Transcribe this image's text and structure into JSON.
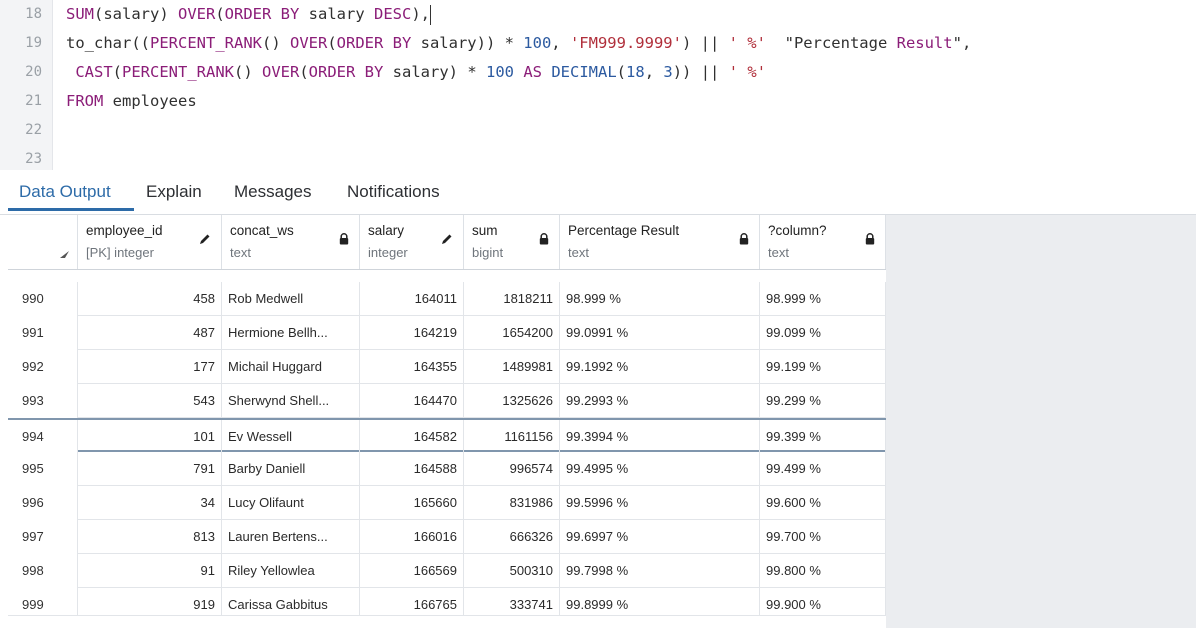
{
  "editor": {
    "lines": [
      {
        "n": "18",
        "parts": [
          [
            "fn",
            "SUM"
          ],
          [
            "p",
            "(salary) "
          ],
          [
            "kw",
            "OVER"
          ],
          [
            "p",
            "("
          ],
          [
            "kw",
            "ORDER BY"
          ],
          [
            "p",
            " salary "
          ],
          [
            "kw",
            "DESC"
          ],
          [
            "p",
            "),"
          ]
        ]
      },
      {
        "n": "19",
        "parts": [
          [
            "p",
            "to_char(("
          ],
          [
            "fn",
            "PERCENT_RANK"
          ],
          [
            "p",
            "() "
          ],
          [
            "kw",
            "OVER"
          ],
          [
            "p",
            "("
          ],
          [
            "kw",
            "ORDER BY"
          ],
          [
            "p",
            " salary)) * "
          ],
          [
            "num",
            "100"
          ],
          [
            "p",
            ", "
          ],
          [
            "str",
            "'FM999.9999'"
          ],
          [
            "p",
            ") || "
          ],
          [
            "str",
            "' %'"
          ],
          [
            "p",
            "  "
          ],
          [
            "p",
            "\"Percentage "
          ],
          [
            "kw",
            "Result"
          ],
          [
            "p",
            "\","
          ]
        ]
      },
      {
        "n": "20",
        "parts": [
          [
            "p",
            " "
          ],
          [
            "kw",
            "CAST"
          ],
          [
            "p",
            "("
          ],
          [
            "fn",
            "PERCENT_RANK"
          ],
          [
            "p",
            "() "
          ],
          [
            "kw",
            "OVER"
          ],
          [
            "p",
            "("
          ],
          [
            "kw",
            "ORDER BY"
          ],
          [
            "p",
            " salary) * "
          ],
          [
            "num",
            "100"
          ],
          [
            "p",
            " "
          ],
          [
            "kw",
            "AS"
          ],
          [
            "p",
            " "
          ],
          [
            "num",
            "DECIMAL"
          ],
          [
            "p",
            "("
          ],
          [
            "num",
            "18"
          ],
          [
            "p",
            ", "
          ],
          [
            "num",
            "3"
          ],
          [
            "p",
            ")) || "
          ],
          [
            "str",
            "' %'"
          ]
        ]
      },
      {
        "n": "21",
        "parts": [
          [
            "kw",
            "FROM"
          ],
          [
            "p",
            " employees"
          ]
        ]
      },
      {
        "n": "22",
        "parts": []
      },
      {
        "n": "23",
        "parts": []
      }
    ]
  },
  "tabs": {
    "data_output": "Data Output",
    "explain": "Explain",
    "messages": "Messages",
    "notifications": "Notifications"
  },
  "columns": [
    {
      "name": "employee_id",
      "type": "[PK] integer",
      "icon": "pencil-icon"
    },
    {
      "name": "concat_ws",
      "type": "text",
      "icon": "lock-icon"
    },
    {
      "name": "salary",
      "type": "integer",
      "icon": "pencil-icon"
    },
    {
      "name": "sum",
      "type": "bigint",
      "icon": "lock-icon"
    },
    {
      "name": "Percentage Result",
      "type": "text",
      "icon": "lock-icon"
    },
    {
      "name": "?column?",
      "type": "text",
      "icon": "lock-icon"
    }
  ],
  "rows": [
    {
      "rn": "990",
      "employee_id": "458",
      "concat_ws": "Rob Medwell",
      "salary": "164011",
      "sum": "1818211",
      "pct": "98.999 %",
      "col": "98.999 %"
    },
    {
      "rn": "991",
      "employee_id": "487",
      "concat_ws": "Hermione Bellh...",
      "salary": "164219",
      "sum": "1654200",
      "pct": "99.0991 %",
      "col": "99.099 %"
    },
    {
      "rn": "992",
      "employee_id": "177",
      "concat_ws": "Michail Huggard",
      "salary": "164355",
      "sum": "1489981",
      "pct": "99.1992 %",
      "col": "99.199 %"
    },
    {
      "rn": "993",
      "employee_id": "543",
      "concat_ws": "Sherwynd Shell...",
      "salary": "164470",
      "sum": "1325626",
      "pct": "99.2993 %",
      "col": "99.299 %"
    },
    {
      "rn": "994",
      "employee_id": "101",
      "concat_ws": "Ev Wessell",
      "salary": "164582",
      "sum": "1161156",
      "pct": "99.3994 %",
      "col": "99.399 %"
    },
    {
      "rn": "995",
      "employee_id": "791",
      "concat_ws": "Barby Daniell",
      "salary": "164588",
      "sum": "996574",
      "pct": "99.4995 %",
      "col": "99.499 %"
    },
    {
      "rn": "996",
      "employee_id": "34",
      "concat_ws": "Lucy Olifaunt",
      "salary": "165660",
      "sum": "831986",
      "pct": "99.5996 %",
      "col": "99.600 %"
    },
    {
      "rn": "997",
      "employee_id": "813",
      "concat_ws": "Lauren Bertens...",
      "salary": "166016",
      "sum": "666326",
      "pct": "99.6997 %",
      "col": "99.700 %"
    },
    {
      "rn": "998",
      "employee_id": "91",
      "concat_ws": "Riley Yellowlea",
      "salary": "166569",
      "sum": "500310",
      "pct": "99.7998 %",
      "col": "99.800 %"
    },
    {
      "rn": "999",
      "employee_id": "919",
      "concat_ws": "Carissa Gabbitus",
      "salary": "166765",
      "sum": "333741",
      "pct": "99.8999 %",
      "col": "99.900 %"
    }
  ],
  "selected_row": "994"
}
